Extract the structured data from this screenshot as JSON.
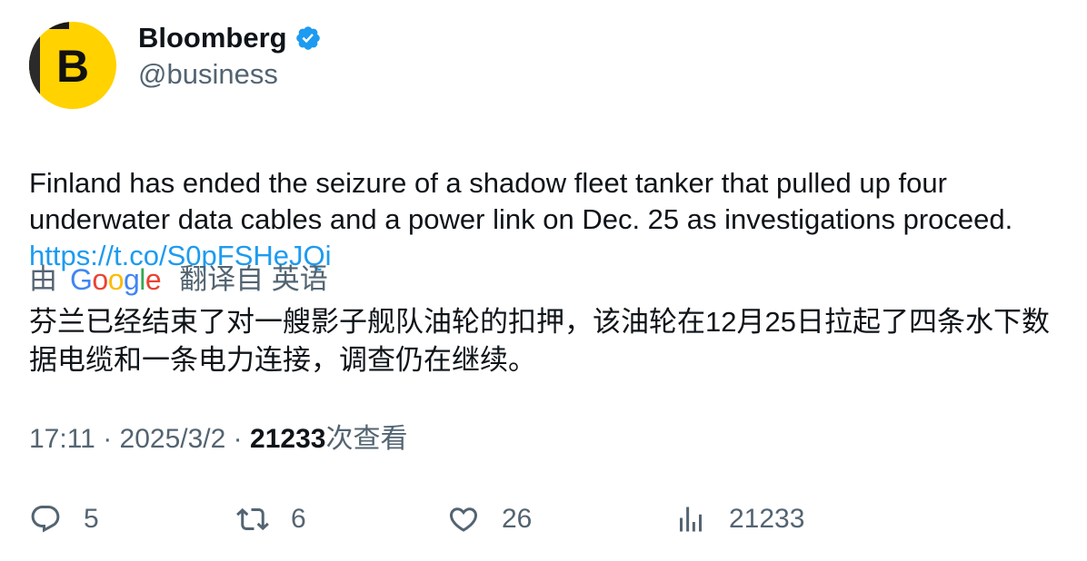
{
  "author": {
    "name": "Bloomberg",
    "handle": "@business",
    "avatar_letter": "B",
    "verified": true
  },
  "tweet": {
    "text": "Finland has ended the seizure of a shadow fleet tanker that pulled up four\nunderwater data cables and a power link on Dec. 25 as investigations proceed.",
    "link": "https://t.co/S0pFSHeJQi"
  },
  "translation": {
    "by_label": "由",
    "provider": "Google",
    "source_label": "翻译自 英语",
    "text": "芬兰已经结束了对一艘影子舰队油轮的扣押，该油轮在12月25日拉起了四条水下数据电缆和一条电力连接，调查仍在继续。"
  },
  "meta": {
    "time": "17:11",
    "separator": "·",
    "date": "2025/3/2",
    "views": "21233",
    "views_label": "次查看"
  },
  "actions": {
    "replies": "5",
    "retweets": "6",
    "likes": "26",
    "views": "21233"
  },
  "colors": {
    "accent": "#1d9bf0",
    "avatar_yellow": "#ffd200",
    "secondary_text": "#536471"
  },
  "icons": [
    "verified-badge-icon",
    "reply-icon",
    "retweet-icon",
    "like-icon",
    "views-icon"
  ]
}
